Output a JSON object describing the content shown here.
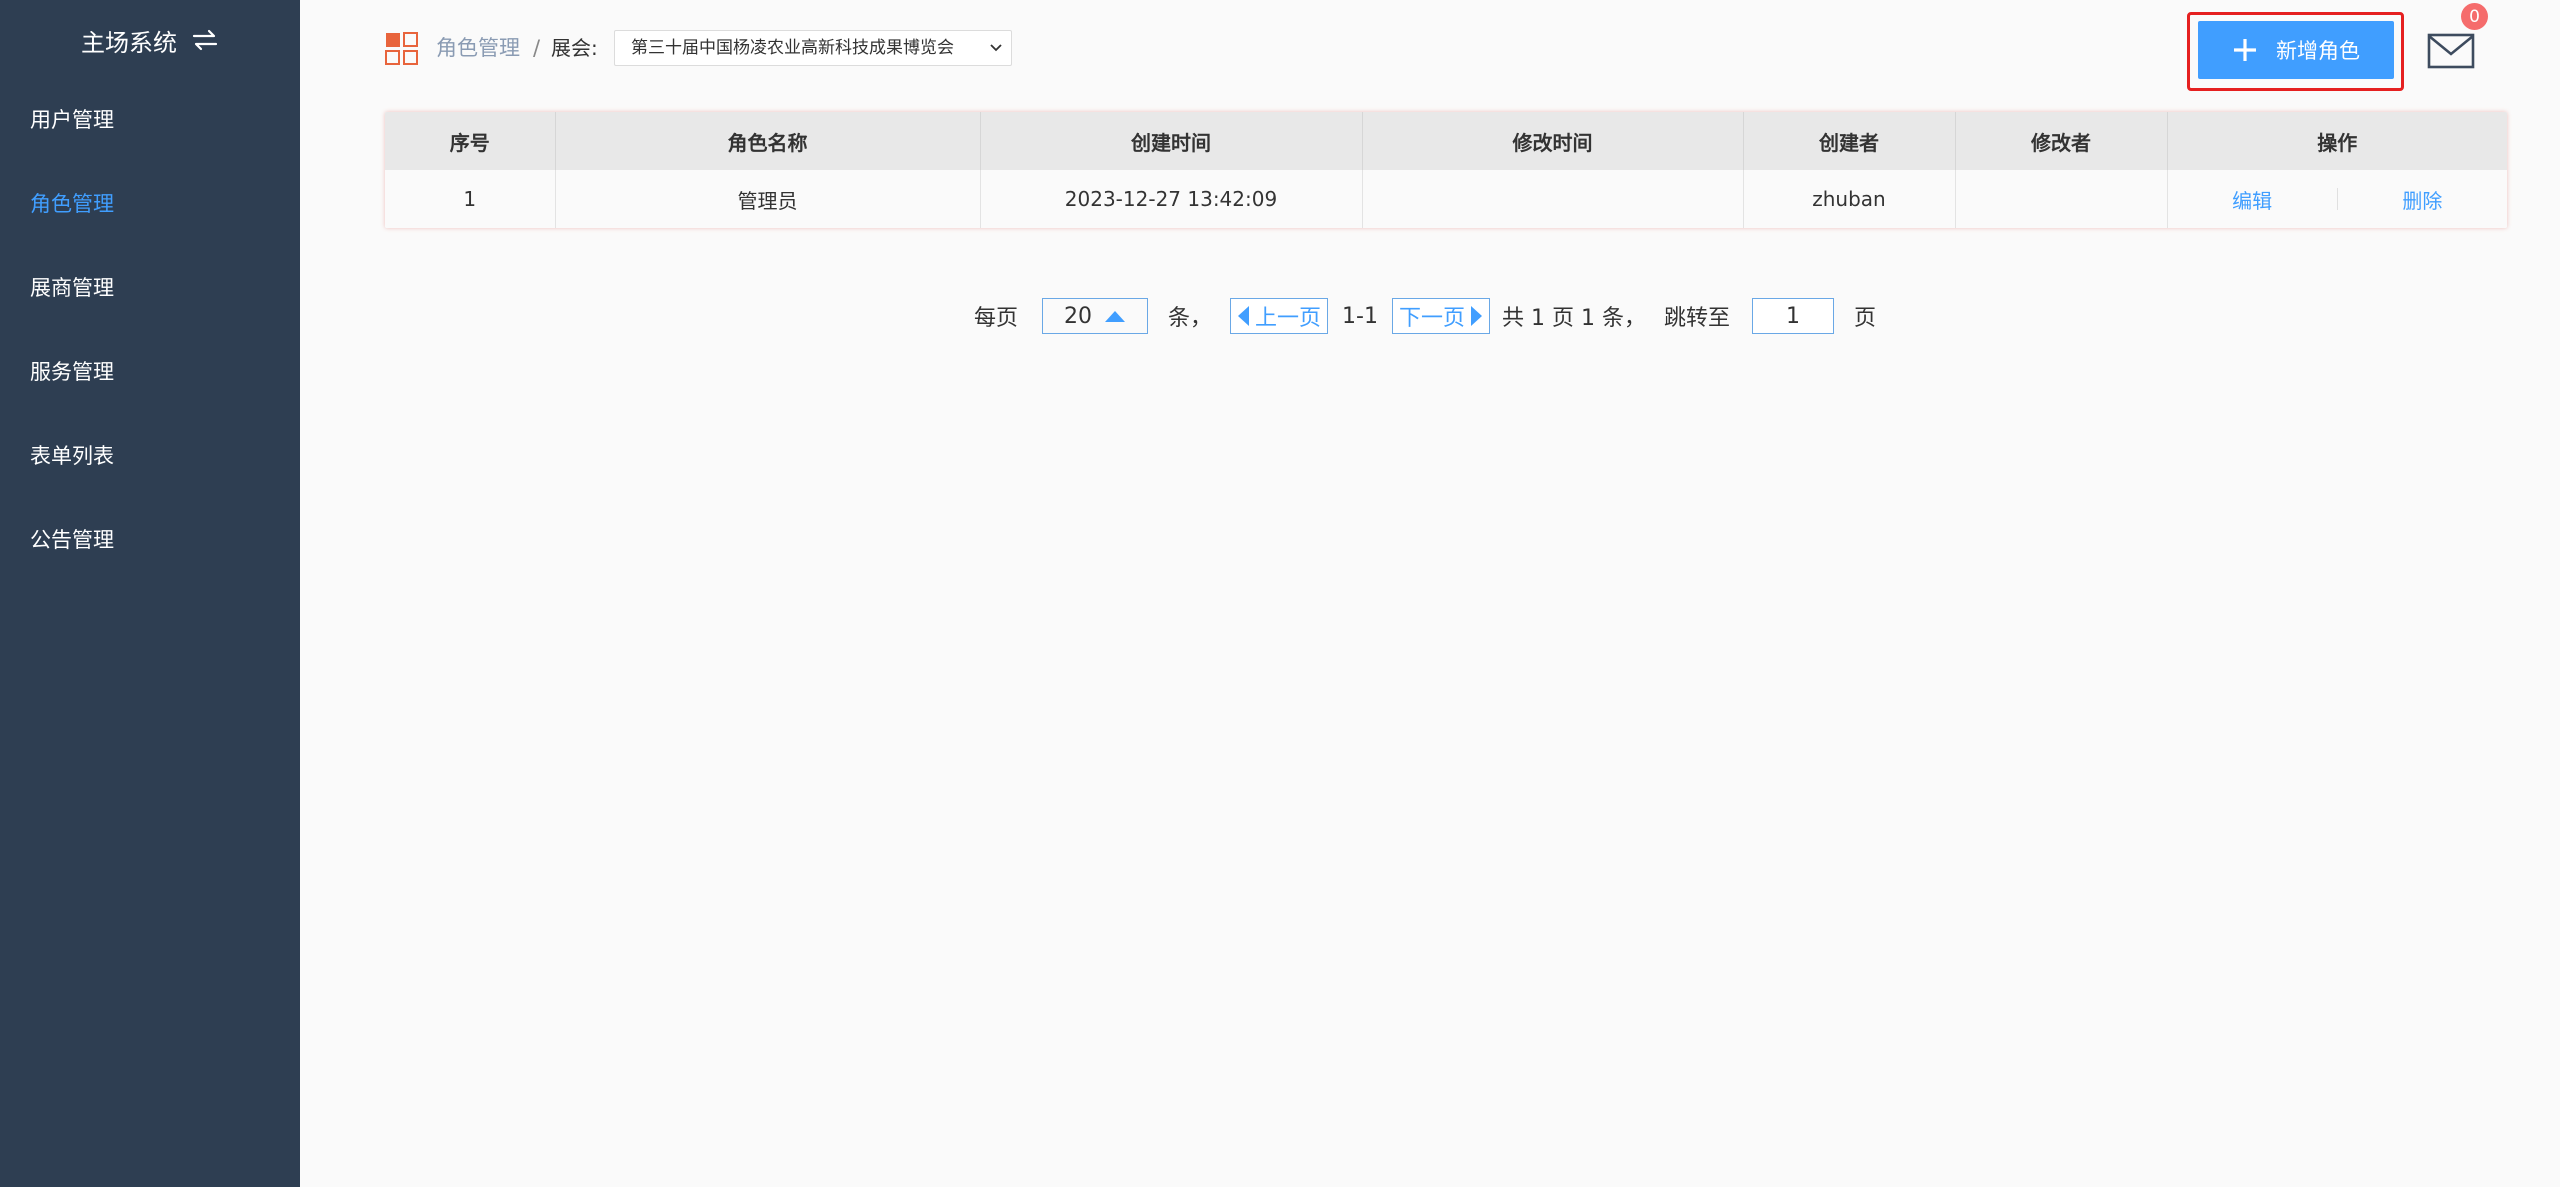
{
  "sidebar": {
    "title": "主场系统",
    "items": [
      {
        "label": "用户管理",
        "active": false
      },
      {
        "label": "角色管理",
        "active": true
      },
      {
        "label": "展商管理",
        "active": false
      },
      {
        "label": "服务管理",
        "active": false
      },
      {
        "label": "表单列表",
        "active": false
      },
      {
        "label": "公告管理",
        "active": false
      }
    ]
  },
  "header": {
    "breadcrumb": "角色管理",
    "separator": "/",
    "expo_label": "展会:",
    "expo_selected": "第三十届中国杨凌农业高新科技成果博览会",
    "add_button": "新增角色",
    "notification_count": "0"
  },
  "table": {
    "columns": [
      "序号",
      "角色名称",
      "创建时间",
      "修改时间",
      "创建者",
      "修改者",
      "操作"
    ],
    "rows": [
      {
        "index": "1",
        "name": "管理员",
        "created_at": "2023-12-27 13:42:09",
        "modified_at": "",
        "creator": "zhuban",
        "modifier": "",
        "edit": "编辑",
        "delete": "删除"
      }
    ]
  },
  "pagination": {
    "per_page_label": "每页",
    "page_size": "20",
    "unit_label": "条，",
    "prev": "上一页",
    "range": "1-1",
    "next": "下一页",
    "summary": "共 1 页 1 条，",
    "jump_label": "跳转至",
    "jump_value": "1",
    "page_unit": "页"
  },
  "colors": {
    "sidebar_bg": "#2e3e52",
    "accent": "#409eff",
    "highlight_border": "#e52020",
    "badge": "#f56c6c",
    "breadcrumb_icon": "#e8643c"
  },
  "icons": [
    "swap-icon",
    "grid-icon",
    "plus-icon",
    "mail-icon",
    "chevron-down-icon",
    "triangle-up-icon",
    "triangle-left-icon",
    "triangle-right-icon"
  ]
}
